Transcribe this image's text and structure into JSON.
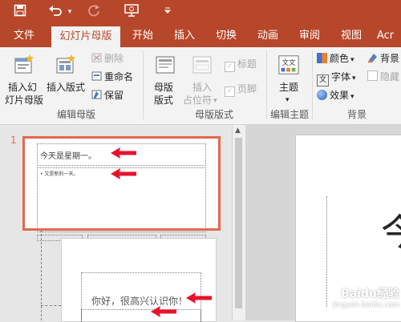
{
  "quick_access": {
    "save_icon": "save-icon",
    "undo_icon": "undo-icon",
    "redo_icon": "redo-icon",
    "present_icon": "present-from-start-icon",
    "customize_icon": "customize-toolbar-icon"
  },
  "tabs": [
    {
      "label": "文件"
    },
    {
      "label": "幻灯片母版",
      "active": true
    },
    {
      "label": "开始"
    },
    {
      "label": "插入"
    },
    {
      "label": "切换"
    },
    {
      "label": "动画"
    },
    {
      "label": "审阅"
    },
    {
      "label": "视图"
    },
    {
      "label": "Acr"
    }
  ],
  "ribbon": {
    "edit_master": {
      "insert_master_line1": "插入幻",
      "insert_master_line2": "灯片母版",
      "insert_layout": "插入版式",
      "delete": "删除",
      "rename": "重命名",
      "preserve": "保留",
      "group_label": "编辑母版"
    },
    "master_layout": {
      "master_layout_line1": "母版",
      "master_layout_line2": "版式",
      "insert_placeholder_line1": "插入",
      "insert_placeholder_line2": "占位符",
      "title_checkbox": "标题",
      "footer_checkbox": "页脚",
      "group_label": "母版版式"
    },
    "edit_theme": {
      "theme": "主题",
      "group_label": "编辑主题"
    },
    "background": {
      "colors": "颜色",
      "fonts": "字体",
      "effects": "效果",
      "bg_styles": "背景",
      "hide_bg": "隐藏",
      "group_label": "背景"
    }
  },
  "slides": {
    "slide1_number": "1",
    "slide1_title": "今天是星期一。",
    "slide1_body": "• 又是新的一天。",
    "slide2_title": "你好，很高兴认识你！"
  },
  "main_slide_char": "今",
  "watermark": {
    "line1": "Baidu经验",
    "line2": "jingyan.baidu.com"
  },
  "colors": {
    "accent": "#b7472a",
    "selection": "#e4694e",
    "arrow": "#e8132b"
  }
}
